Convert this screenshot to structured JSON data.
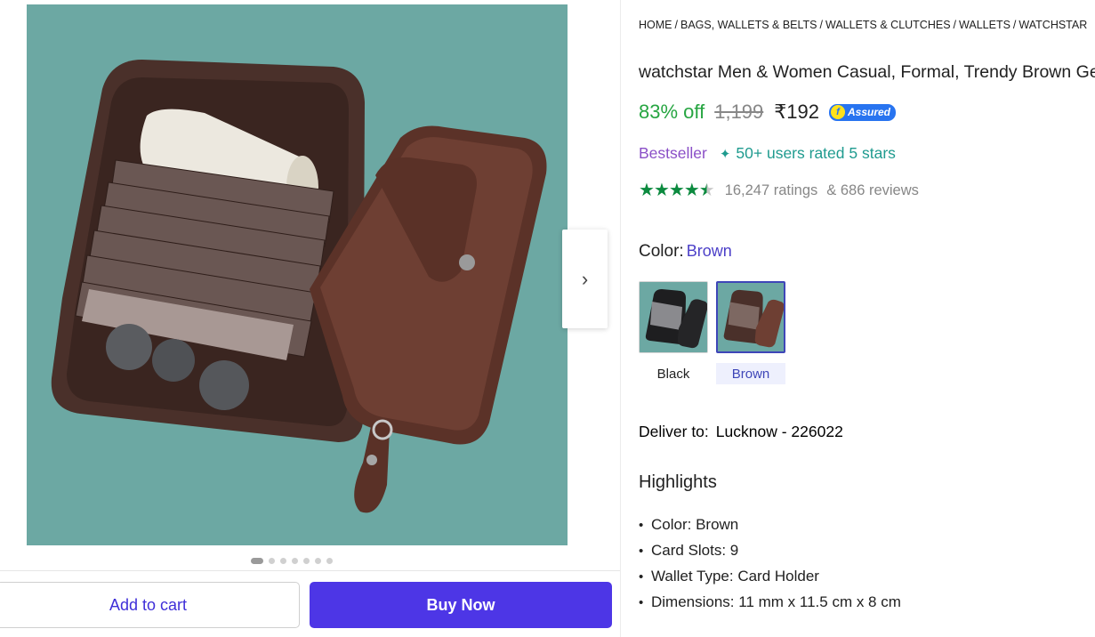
{
  "buttons": {
    "add_to_cart": "Add to cart",
    "buy_now": "Buy Now"
  },
  "gallery": {
    "dot_count": 7,
    "active_index": 0
  },
  "breadcrumb": [
    "HOME",
    "BAGS, WALLETS & BELTS",
    "WALLETS & CLUTCHES",
    "WALLETS",
    "WATCHSTAR"
  ],
  "product": {
    "title": "watchstar Men & Women Casual, Formal, Trendy Brown Genuine Leather Card Holder",
    "discount": "83% off",
    "mrp": "1,199",
    "price": "₹192",
    "assured_label": "Assured",
    "bestseller": "Bestseller",
    "users_rated": "50+ users rated 5 stars",
    "rating_value": 4.5,
    "ratings_count": "16,247 ratings",
    "reviews_count": "& 686 reviews"
  },
  "color": {
    "label": "Color:",
    "selected": "Brown",
    "options": [
      "Black",
      "Brown"
    ]
  },
  "delivery": {
    "label": "Deliver to:",
    "location": "Lucknow - 226022"
  },
  "highlights": {
    "title": "Highlights",
    "items": [
      "Color: Brown",
      "Card Slots: 9",
      "Wallet Type: Card Holder",
      "Dimensions: 11 mm x 11.5 cm x 8 cm"
    ]
  },
  "colors": {
    "primary": "#4d36e6",
    "discount_green": "#26a541",
    "bestseller_purple": "#8a4fc7",
    "rated_teal": "#1f9b8f",
    "star_green": "#0c8a3f",
    "assured_blue": "#2874f0"
  }
}
